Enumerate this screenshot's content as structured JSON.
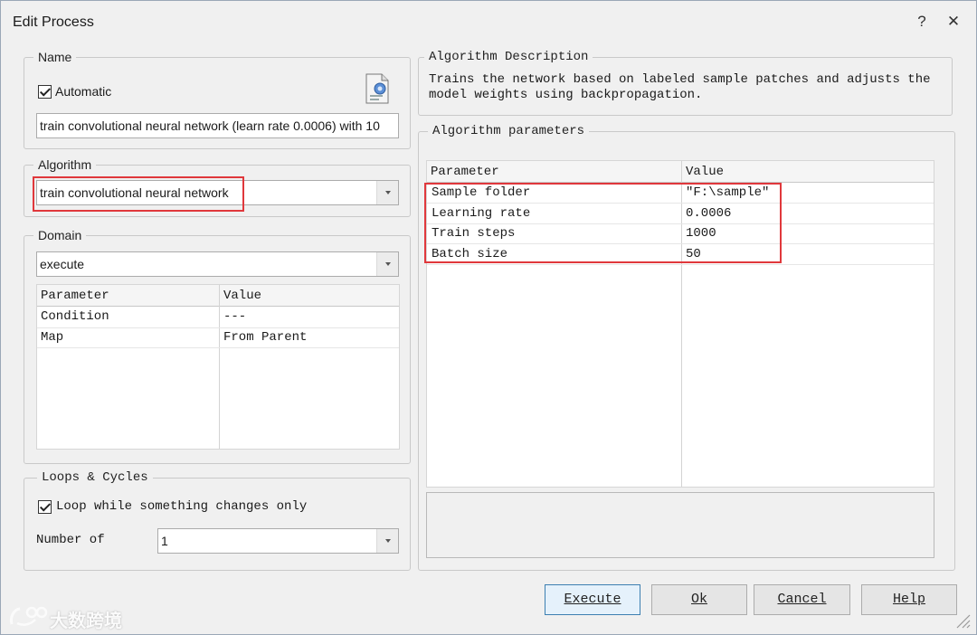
{
  "window": {
    "title": "Edit Process",
    "help_glyph": "?",
    "close_glyph": "✕"
  },
  "name_group": {
    "legend": "Name",
    "automatic_label": "Automatic",
    "automatic_checked": true,
    "name_value": "train convolutional neural network (learn rate 0.0006) with 10",
    "icon": "process-document-icon"
  },
  "algorithm_group": {
    "legend": "Algorithm",
    "selected": "train convolutional neural network"
  },
  "domain_group": {
    "legend": "Domain",
    "selected": "execute",
    "columns": [
      "Parameter",
      "Value"
    ],
    "rows": [
      {
        "parameter": "Condition",
        "value": "---"
      },
      {
        "parameter": "Map",
        "value": "From Parent"
      }
    ]
  },
  "loops_group": {
    "legend": "Loops & Cycles",
    "loop_label": "Loop while something changes only",
    "loop_checked": true,
    "number_label": "Number of",
    "number_value": "1"
  },
  "description_group": {
    "legend": "Algorithm Description",
    "text": "Trains the network based on labeled sample patches and adjusts the model weights using backpropagation."
  },
  "parameters_group": {
    "legend": "Algorithm parameters",
    "columns": [
      "Parameter",
      "Value"
    ],
    "rows": [
      {
        "parameter": "Sample folder",
        "value": "\"F:\\sample\""
      },
      {
        "parameter": "Learning rate",
        "value": "0.0006"
      },
      {
        "parameter": "Train steps",
        "value": "1000"
      },
      {
        "parameter": "Batch size",
        "value": "50"
      }
    ]
  },
  "buttons": {
    "execute": "Execute",
    "ok": "Ok",
    "cancel": "Cancel",
    "help": "Help"
  },
  "watermark": "大数跨境",
  "colors": {
    "highlight": "#e0383c",
    "default_button_border": "#3c7fb1"
  }
}
